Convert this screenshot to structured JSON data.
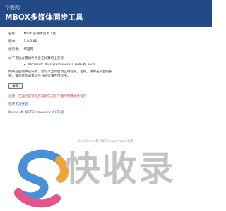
{
  "header": {
    "brand": "华医网",
    "title": "MBOX多媒体同步工具"
  },
  "meta": {
    "name_label": "名称:",
    "name_value": "MBOX多媒体同步工具",
    "version_label": "版本:",
    "version_value": "1.0.0.86",
    "publisher_label": "发行者:",
    "publisher_value": "华医网"
  },
  "requirements": {
    "title": "以下系统必需组件将会在计算机上安装:",
    "items": [
      "Microsoft .NET Framework 4 (x86 和 x64)"
    ]
  },
  "description": "如果这些组件已安装，您可以立即启动应用程序。否则，请单击下面的按钮，安装这些必需组件并运行该应用程序。",
  "install_button": "安装",
  "warning": "注意：在运行安装程序前请先安装下面的所需组件程序",
  "help_link": "程序无法安装",
  "dotnet_link": "Microsoft .NET Framework 4.0下载",
  "footer_link": "ClickOnce 和 .NET Framework 资源",
  "watermark": {
    "text": "快收录",
    "colors": [
      "#4a90d9",
      "#f1a33a",
      "#e4568a"
    ]
  }
}
